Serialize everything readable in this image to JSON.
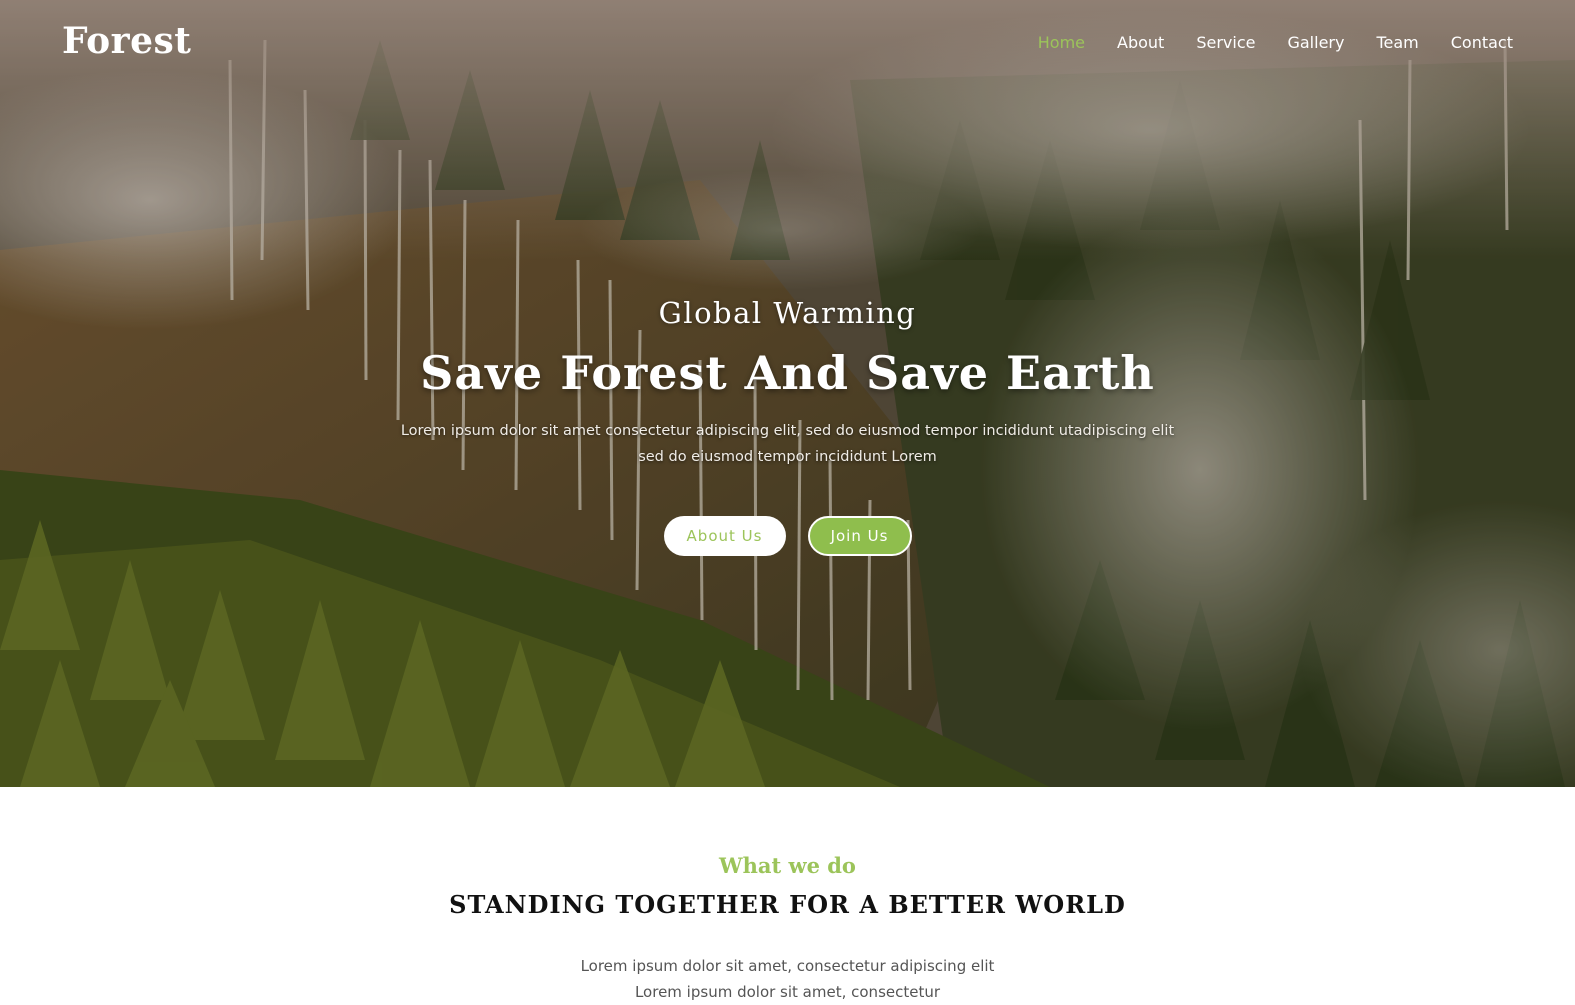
{
  "brand": {
    "logo": "Forest"
  },
  "nav": {
    "items": [
      {
        "label": "Home",
        "active": true
      },
      {
        "label": "About",
        "active": false
      },
      {
        "label": "Service",
        "active": false
      },
      {
        "label": "Gallery",
        "active": false
      },
      {
        "label": "Team",
        "active": false
      },
      {
        "label": "Contact",
        "active": false
      }
    ]
  },
  "hero": {
    "subtitle": "Global Warming",
    "title": "Save Forest And Save Earth",
    "description": "Lorem ipsum dolor sit amet consectetur adipiscing elit, sed do eiusmod tempor incididunt utadipiscing elit sed do eiusmod tempor incididunt Lorem",
    "buttons": {
      "about": "About Us",
      "join": "Join Us"
    }
  },
  "section": {
    "subtitle": "What we do",
    "title": "STANDING TOGETHER FOR A BETTER WORLD",
    "line1": "Lorem ipsum dolor sit amet, consectetur adipiscing elit",
    "line2": "Lorem ipsum dolor sit amet, consectetur"
  },
  "colors": {
    "accent": "#9cc45a",
    "button_join": "#8fbe4d"
  }
}
